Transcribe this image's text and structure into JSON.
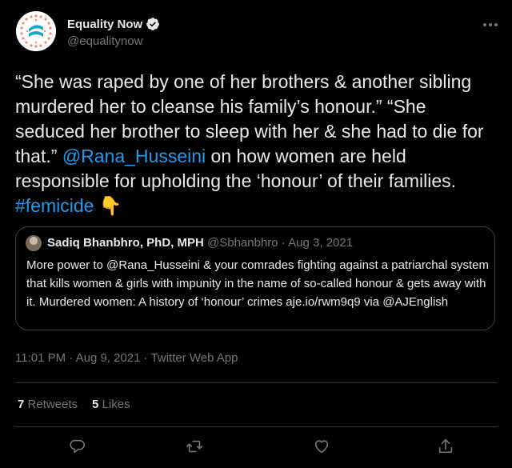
{
  "author": {
    "name": "Equality Now",
    "handle": "@equalitynow",
    "verified": true,
    "avatar_icon": "equality-now-logo-icon"
  },
  "tweet": {
    "text_parts": [
      "“She was raped by one of her brothers & another sibling murdered her to cleanse his family’s honour.” “She seduced her brother to sleep with her & she had to die for that.” ",
      "@Rana_Husseini",
      " on how women are held responsible for upholding the ‘honour’ of their families. ",
      "#femicide",
      " 👇"
    ]
  },
  "quote": {
    "name": "Sadiq Bhanbhro, PhD, MPH",
    "handle": "@Sbhanbhro",
    "separator": " · ",
    "date": "Aug 3, 2021",
    "text": "More power to @Rana_Husseini & your comrades fighting against a patriarchal system that kills women & girls with impunity in the name of so-called honour & gets away with it. Murdered women: A history of ‘honour’ crimes aje.io/rwm9q9 via @AJEnglish"
  },
  "meta": {
    "timestamp": "11:01 PM · Aug 9, 2021 · Twitter Web App"
  },
  "stats": {
    "retweets_count": "7",
    "retweets_label": "Retweets",
    "likes_count": "5",
    "likes_label": "Likes"
  },
  "actions": [
    {
      "name": "reply",
      "icon": "reply-icon"
    },
    {
      "name": "retweet",
      "icon": "retweet-icon"
    },
    {
      "name": "like",
      "icon": "heart-icon"
    },
    {
      "name": "share",
      "icon": "share-icon"
    }
  ],
  "colors": {
    "background": "#000000",
    "text": "#e7e9ea",
    "secondary": "#71767b",
    "link": "#1d9bf0",
    "border": "#2f3336",
    "verified": "#1d9bf0"
  }
}
